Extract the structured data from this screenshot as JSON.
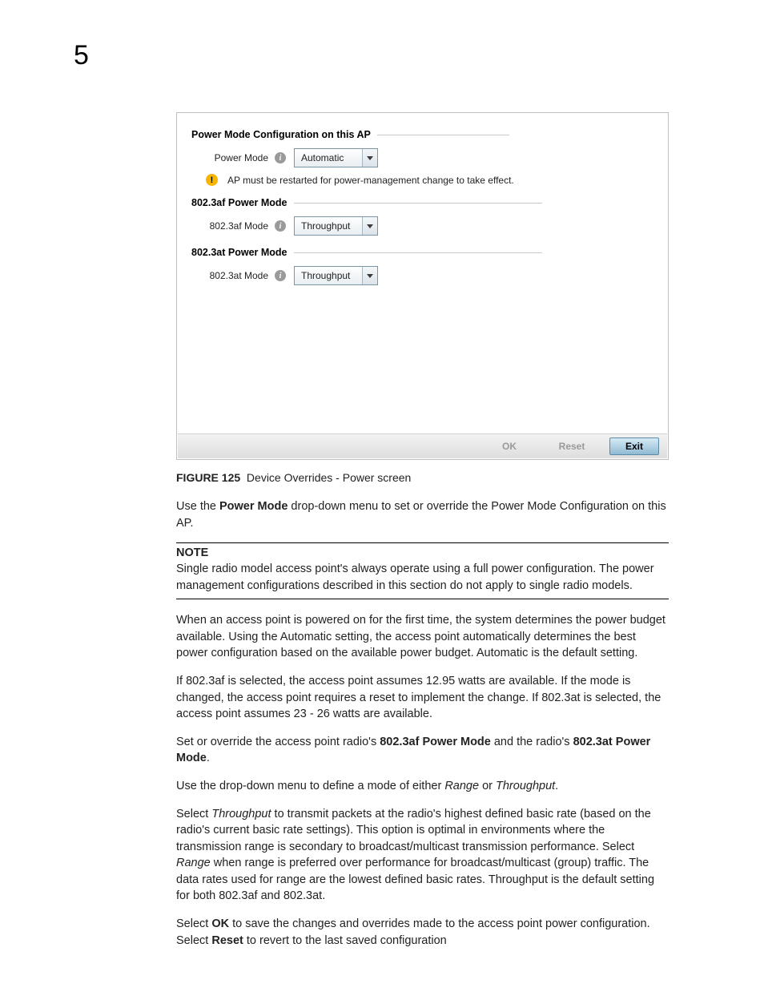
{
  "chapterNumber": "5",
  "ui": {
    "section1": {
      "title": "Power Mode Configuration on this AP",
      "field": {
        "label": "Power Mode",
        "value": "Automatic"
      },
      "warning": "AP must be restarted for power-management change to take effect."
    },
    "section2": {
      "title": "802.3af Power Mode",
      "field": {
        "label": "802.3af Mode",
        "value": "Throughput"
      }
    },
    "section3": {
      "title": "802.3at Power Mode",
      "field": {
        "label": "802.3at Mode",
        "value": "Throughput"
      }
    },
    "buttons": {
      "ok": "OK",
      "reset": "Reset",
      "exit": "Exit"
    }
  },
  "figure": {
    "label": "FIGURE 125",
    "caption": "Device Overrides - Power screen"
  },
  "p1a": "Use the ",
  "p1b": "Power Mode",
  "p1c": " drop-down menu to set or override the Power Mode Configuration on this AP.",
  "note": {
    "title": "NOTE",
    "body": "Single radio model access point's always operate using a full power configuration. The power management configurations described in this section do not apply to single radio models."
  },
  "p2": "When an access point is powered on for the first time, the system determines the power budget available. Using the Automatic setting, the access point automatically determines the best power configuration based on the available power budget. Automatic is the default setting.",
  "p3": "If 802.3af is selected, the access point assumes 12.95 watts are available. If the mode is changed, the access point requires a reset to implement the change. If 802.3at is selected, the access point assumes 23 - 26 watts are available.",
  "p4a": "Set or override the access point radio's ",
  "p4b": "802.3af Power Mode",
  "p4c": " and the radio's ",
  "p4d": "802.3at Power Mode",
  "p4e": ".",
  "p5a": "Use the drop-down menu to define a mode of either ",
  "p5b": "Range",
  "p5c": " or ",
  "p5d": "Throughput",
  "p5e": ".",
  "p6a": "Select ",
  "p6b": "Throughput",
  "p6c": " to transmit packets at the radio's highest defined basic rate (based on the radio's current basic rate settings). This option is optimal in environments where the transmission range is secondary to broadcast/multicast transmission performance. Select ",
  "p6d": "Range",
  "p6e": " when range is preferred over performance for broadcast/multicast (group) traffic. The data rates used for range are the lowest defined basic rates. Throughput is the default setting for both 802.3af and 802.3at.",
  "p7a": "Select ",
  "p7b": "OK",
  "p7c": " to save the changes and overrides made to the access point power configuration. Select ",
  "p7d": "Reset",
  "p7e": " to revert to the last saved configuration"
}
